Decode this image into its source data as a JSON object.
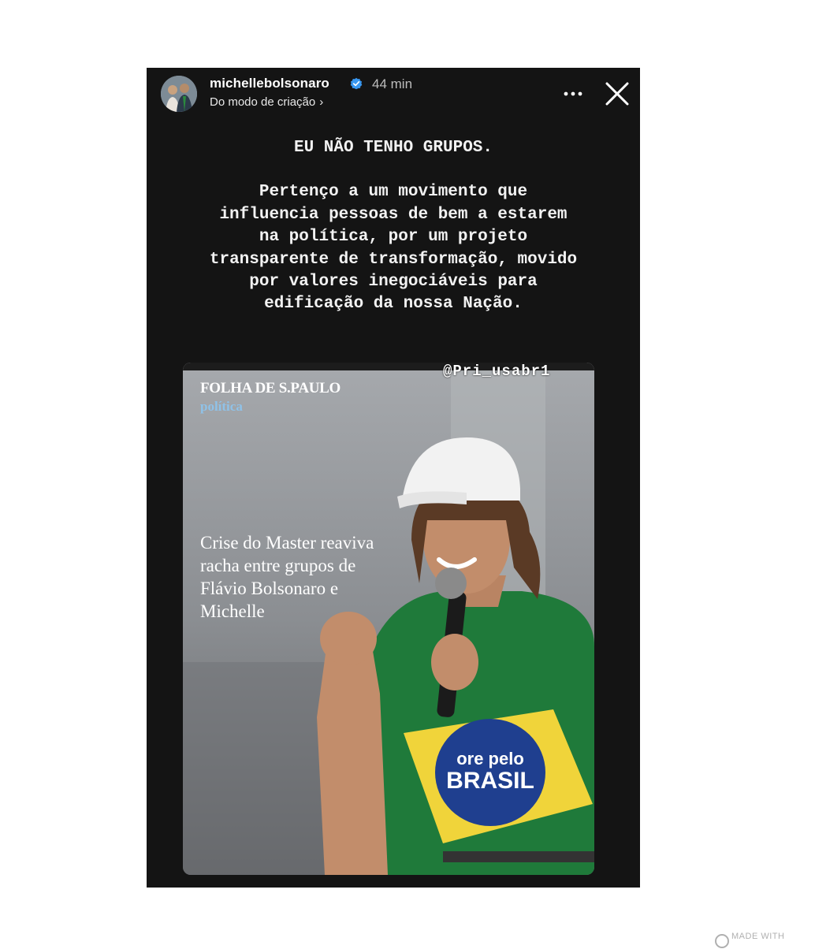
{
  "story": {
    "username": "michellebolsonaro",
    "time_ago": "44 min",
    "subline": "Do modo de criação",
    "heading": "EU NÃO TENHO GRUPOS.",
    "body_lines": [
      "Pertenço a um movimento que",
      "influencia pessoas de bem a estarem",
      "na política, por um projeto",
      "transparente de transformação, movido",
      "por valores inegociáveis para",
      "edificação da nossa Nação."
    ]
  },
  "post": {
    "watermark": "@Pri_usabr1",
    "publication": "FOLHA DE S.PAULO",
    "section": "política",
    "headline": "Crise do Master reaviva racha entre grupos de Flávio Bolsonaro e Michelle",
    "shirt_text_1": "ore pelo",
    "shirt_text_2": "BRASIL"
  },
  "footer": {
    "made_with": "MADE WITH"
  },
  "icons": {
    "verified": "verified-badge-icon",
    "more": "more-options-icon",
    "close": "close-icon",
    "chevron": "chevron-right-icon"
  },
  "colors": {
    "story_bg": "#141414",
    "verified_blue": "#3897f0",
    "section_blue": "#8fc2e8",
    "shirt_green": "#1f7a3a",
    "shirt_yellow": "#f0d43a",
    "globe_blue": "#1f3f8f"
  }
}
